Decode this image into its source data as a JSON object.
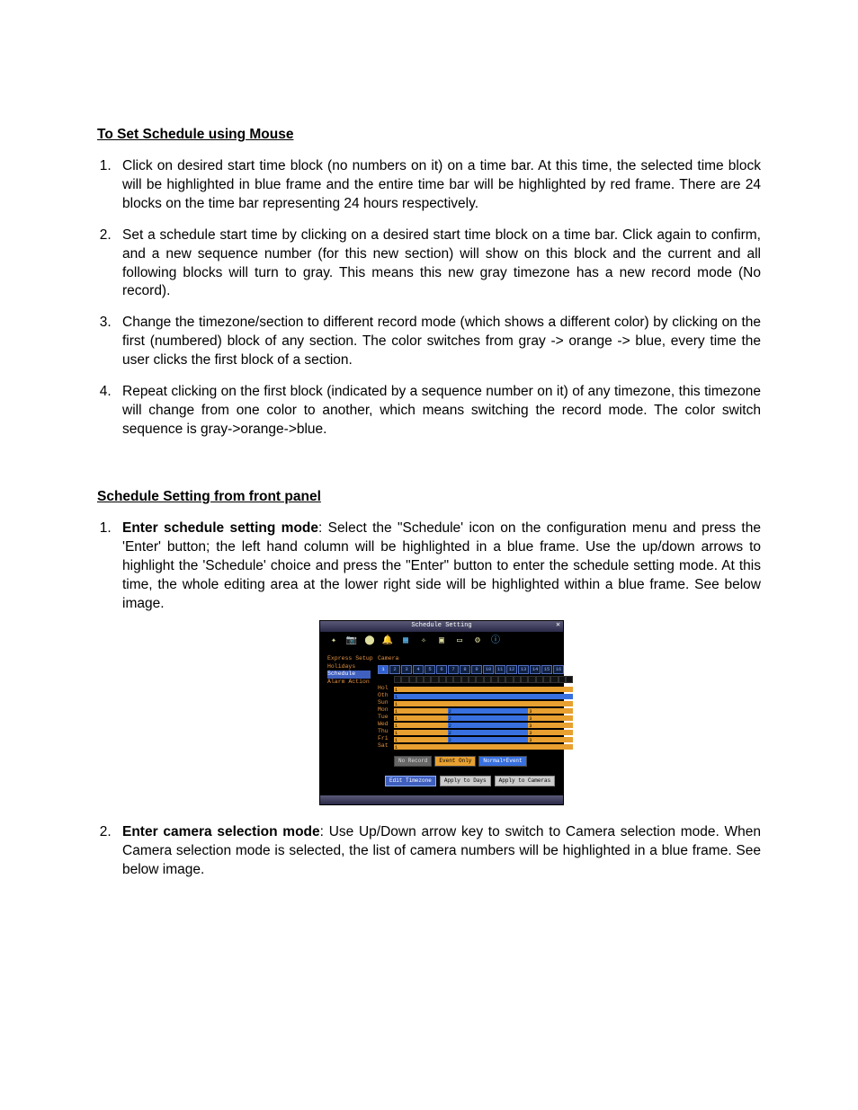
{
  "h1": "To Set Schedule using Mouse",
  "p1_li1": "Click on desired start time block (no numbers on it) on a time bar. At this time, the selected time block will be highlighted in blue frame and the entire time bar will be highlighted by red frame. There are 24 blocks on the time bar representing 24 hours respectively.",
  "p1_li2": "Set a schedule start time by clicking on a desired start time block on a time bar.  Click again to confirm, and a new sequence number (for this new section) will show on this block and the current and all following blocks will turn to gray. This means this new gray timezone has a new record mode (No record).",
  "p1_li3": "Change the timezone/section to different record mode (which shows a different color) by clicking on the first (numbered) block of any section. The color switches from gray -> orange -> blue, every time the user clicks the first block of a section.",
  "p1_li4": "Repeat clicking on the first block (indicated by a sequence number on it) of any timezone, this timezone will change from one color to another, which means switching the record mode. The color switch sequence is gray->orange->blue.",
  "h2": "Schedule Setting from front panel",
  "p2_li1_b": "Enter schedule setting mode",
  "p2_li1": ": Select the \"Schedule' icon on the configuration menu and press the 'Enter' button; the left hand column will be highlighted in a blue frame. Use the up/down arrows to highlight the 'Schedule' choice and press the \"Enter\" button to enter the schedule setting mode. At this time, the whole editing area at the lower right side will be highlighted within a blue frame. See below image.",
  "p2_li2_b": "Enter camera selection mode",
  "p2_li2": ": Use Up/Down arrow key to switch to Camera selection mode. When Camera selection mode is selected, the list of camera numbers will be highlighted in a blue frame. See below image.",
  "shot": {
    "title": "Schedule Setting",
    "side": [
      "Express Setup",
      "Holidays",
      "Schedule",
      "Alarm Action"
    ],
    "camera_label": "Camera",
    "cams": [
      "1",
      "2",
      "3",
      "4",
      "5",
      "6",
      "7",
      "8",
      "9",
      "10",
      "11",
      "12",
      "13",
      "14",
      "15",
      "16"
    ],
    "days": [
      "Hol",
      "Oth",
      "Sun",
      "Mon",
      "Tue",
      "Wed",
      "Thu",
      "Fri",
      "Sat"
    ],
    "legend": {
      "nr": "No Record",
      "eo": "Event Only",
      "ne": "Normal+Event"
    },
    "buttons": {
      "edit": "Edit Timezone",
      "days": "Apply to Days",
      "cams": "Apply to Cameras"
    }
  }
}
